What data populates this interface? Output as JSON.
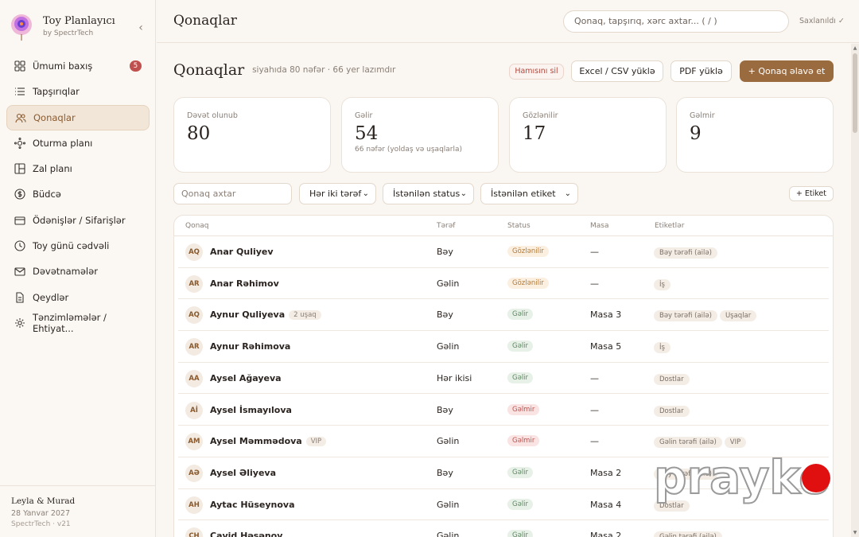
{
  "app": {
    "title": "Toy Planlayıcı",
    "subtitle": "by SpectrTech",
    "collapse": "‹"
  },
  "sidebar": {
    "items": [
      {
        "label": "Ümumi baxış",
        "icon": "grid-icon",
        "badge": "5"
      },
      {
        "label": "Tapşırıqlar",
        "icon": "list-icon"
      },
      {
        "label": "Qonaqlar",
        "icon": "users-icon",
        "active": true
      },
      {
        "label": "Oturma planı",
        "icon": "seating-icon"
      },
      {
        "label": "Zal planı",
        "icon": "layout-icon"
      },
      {
        "label": "Büdcə",
        "icon": "coin-icon"
      },
      {
        "label": "Ödənişlər / Sifarişlər",
        "icon": "card-icon"
      },
      {
        "label": "Toy günü cədvəli",
        "icon": "clock-icon"
      },
      {
        "label": "Dəvətnamələr",
        "icon": "mail-icon"
      },
      {
        "label": "Qeydlər",
        "icon": "document-icon"
      },
      {
        "label": "Tənzimləmələr / Ehtiyat...",
        "icon": "gear-icon"
      }
    ],
    "footer": {
      "couple": "Leyla & Murad",
      "date": "28 Yanvar 2027",
      "version": "SpectrTech · v21"
    }
  },
  "topbar": {
    "title": "Qonaqlar",
    "search_placeholder": "Qonaq, tapşırıq, xərc axtar...  ( / )",
    "saved": "Saxlanıldı ✓"
  },
  "page": {
    "title": "Qonaqlar",
    "subtitle": "siyahıda 80 nəfər · 66 yer lazımdır",
    "buttons": {
      "delete_all": "Hamısını sil",
      "excel": "Excel / CSV yüklə",
      "pdf": "PDF yüklə",
      "add": "+ Qonaq əlavə et"
    }
  },
  "stats": [
    {
      "label": "Dəvət olunub",
      "value": "80",
      "note": ""
    },
    {
      "label": "Gəlir",
      "value": "54",
      "note": "66 nəfər (yoldaş və uşaqlarla)"
    },
    {
      "label": "Gözlənilir",
      "value": "17",
      "note": ""
    },
    {
      "label": "Gəlmir",
      "value": "9",
      "note": ""
    }
  ],
  "filters": {
    "search_placeholder": "Qonaq axtar",
    "side": "Hər iki tərəf",
    "status": "İstənilən status",
    "tag": "İstənilən etiket",
    "add_tag": "+ Etiket"
  },
  "table": {
    "headers": {
      "guest": "Qonaq",
      "side": "Tərəf",
      "status": "Status",
      "table": "Masa",
      "tags": "Etiketlər"
    },
    "rows": [
      {
        "initials": "AQ",
        "name": "Anar Quliyev",
        "extra": "",
        "side": "Bəy",
        "status": "Gözlənilir",
        "status_type": "pending",
        "table": "—",
        "tags": [
          "Bəy tərəfi (ailə)"
        ]
      },
      {
        "initials": "AR",
        "name": "Anar Rəhimov",
        "extra": "",
        "side": "Gəlin",
        "status": "Gözlənilir",
        "status_type": "pending",
        "table": "—",
        "tags": [
          "İş"
        ]
      },
      {
        "initials": "AQ",
        "name": "Aynur Quliyeva",
        "extra": "2 uşaq",
        "side": "Bəy",
        "status": "Gəlir",
        "status_type": "coming",
        "table": "Masa 3",
        "tags": [
          "Bəy tərəfi (ailə)",
          "Uşaqlar"
        ]
      },
      {
        "initials": "AR",
        "name": "Aynur Rəhimova",
        "extra": "",
        "side": "Gəlin",
        "status": "Gəlir",
        "status_type": "coming",
        "table": "Masa 5",
        "tags": [
          "İş"
        ]
      },
      {
        "initials": "AA",
        "name": "Aysel Ağayeva",
        "extra": "",
        "side": "Hər ikisi",
        "status": "Gəlir",
        "status_type": "coming",
        "table": "—",
        "tags": [
          "Dostlar"
        ]
      },
      {
        "initials": "Aİ",
        "name": "Aysel İsmayılova",
        "extra": "",
        "side": "Bəy",
        "status": "Gəlmir",
        "status_type": "not",
        "table": "—",
        "tags": [
          "Dostlar"
        ]
      },
      {
        "initials": "AM",
        "name": "Aysel Məmmədova",
        "extra": "VIP",
        "side": "Gəlin",
        "status": "Gəlmir",
        "status_type": "not",
        "table": "—",
        "tags": [
          "Gəlin tərəfi (ailə)",
          "VIP"
        ]
      },
      {
        "initials": "AƏ",
        "name": "Aysel Əliyeva",
        "extra": "",
        "side": "Bəy",
        "status": "Gəlir",
        "status_type": "coming",
        "table": "Masa 2",
        "tags": [
          "Bəy tərəfi (ailə)"
        ]
      },
      {
        "initials": "AH",
        "name": "Aytac Hüseynova",
        "extra": "",
        "side": "Gəlin",
        "status": "Gəlir",
        "status_type": "coming",
        "table": "Masa 4",
        "tags": [
          "Dostlar"
        ]
      },
      {
        "initials": "CH",
        "name": "Cavid Həsənov",
        "extra": "",
        "side": "Gəlin",
        "status": "Gəlir",
        "status_type": "coming",
        "table": "Masa 2",
        "tags": [
          "Gəlin tərəfi (ailə)"
        ]
      }
    ]
  },
  "watermark": {
    "text": "prayko"
  },
  "colors": {
    "accent": "#9a6b3f",
    "danger": "#c0504d",
    "success": "#5a8a5f",
    "warning": "#b07a3a"
  }
}
